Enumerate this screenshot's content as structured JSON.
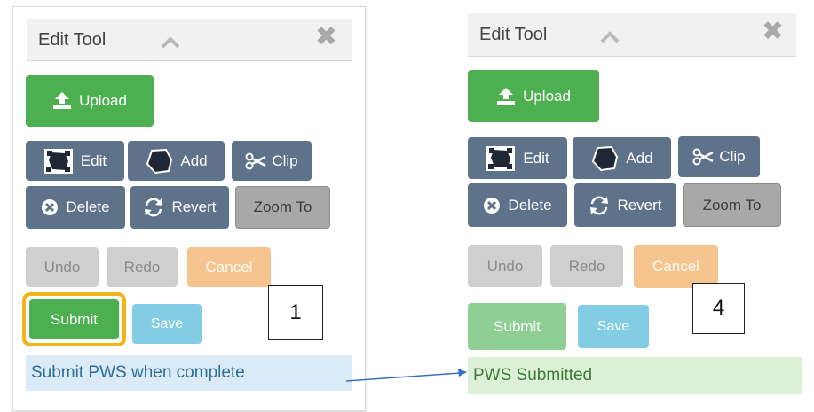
{
  "left_panel": {
    "title": "Edit Tool",
    "buttons": {
      "upload": "Upload",
      "edit": "Edit",
      "add": "Add",
      "clip": "Clip",
      "delete": "Delete",
      "revert": "Revert",
      "zoom_to": "Zoom To",
      "undo": "Undo",
      "redo": "Redo",
      "cancel": "Cancel",
      "submit": "Submit",
      "save": "Save"
    },
    "message": "Submit PWS when complete",
    "step_number": "1"
  },
  "right_panel": {
    "title": "Edit Tool",
    "buttons": {
      "upload": "Upload",
      "edit": "Edit",
      "add": "Add",
      "clip": "Clip",
      "delete": "Delete",
      "revert": "Revert",
      "zoom_to": "Zoom To",
      "undo": "Undo",
      "redo": "Redo",
      "cancel": "Cancel",
      "submit": "Submit",
      "save": "Save"
    },
    "message": "PWS Submitted",
    "step_number": "4"
  },
  "colors": {
    "green": "#4cb050",
    "slate": "#5e738a",
    "orange": "#f6c58f",
    "sky": "#82cde4",
    "highlight": "#f2b41b",
    "arrow": "#3a6fc4"
  },
  "icons": [
    "upload-icon",
    "edit-shape-icon",
    "add-shape-icon",
    "scissors-icon",
    "delete-circle-icon",
    "revert-icon",
    "chevron-up-icon",
    "close-icon"
  ]
}
